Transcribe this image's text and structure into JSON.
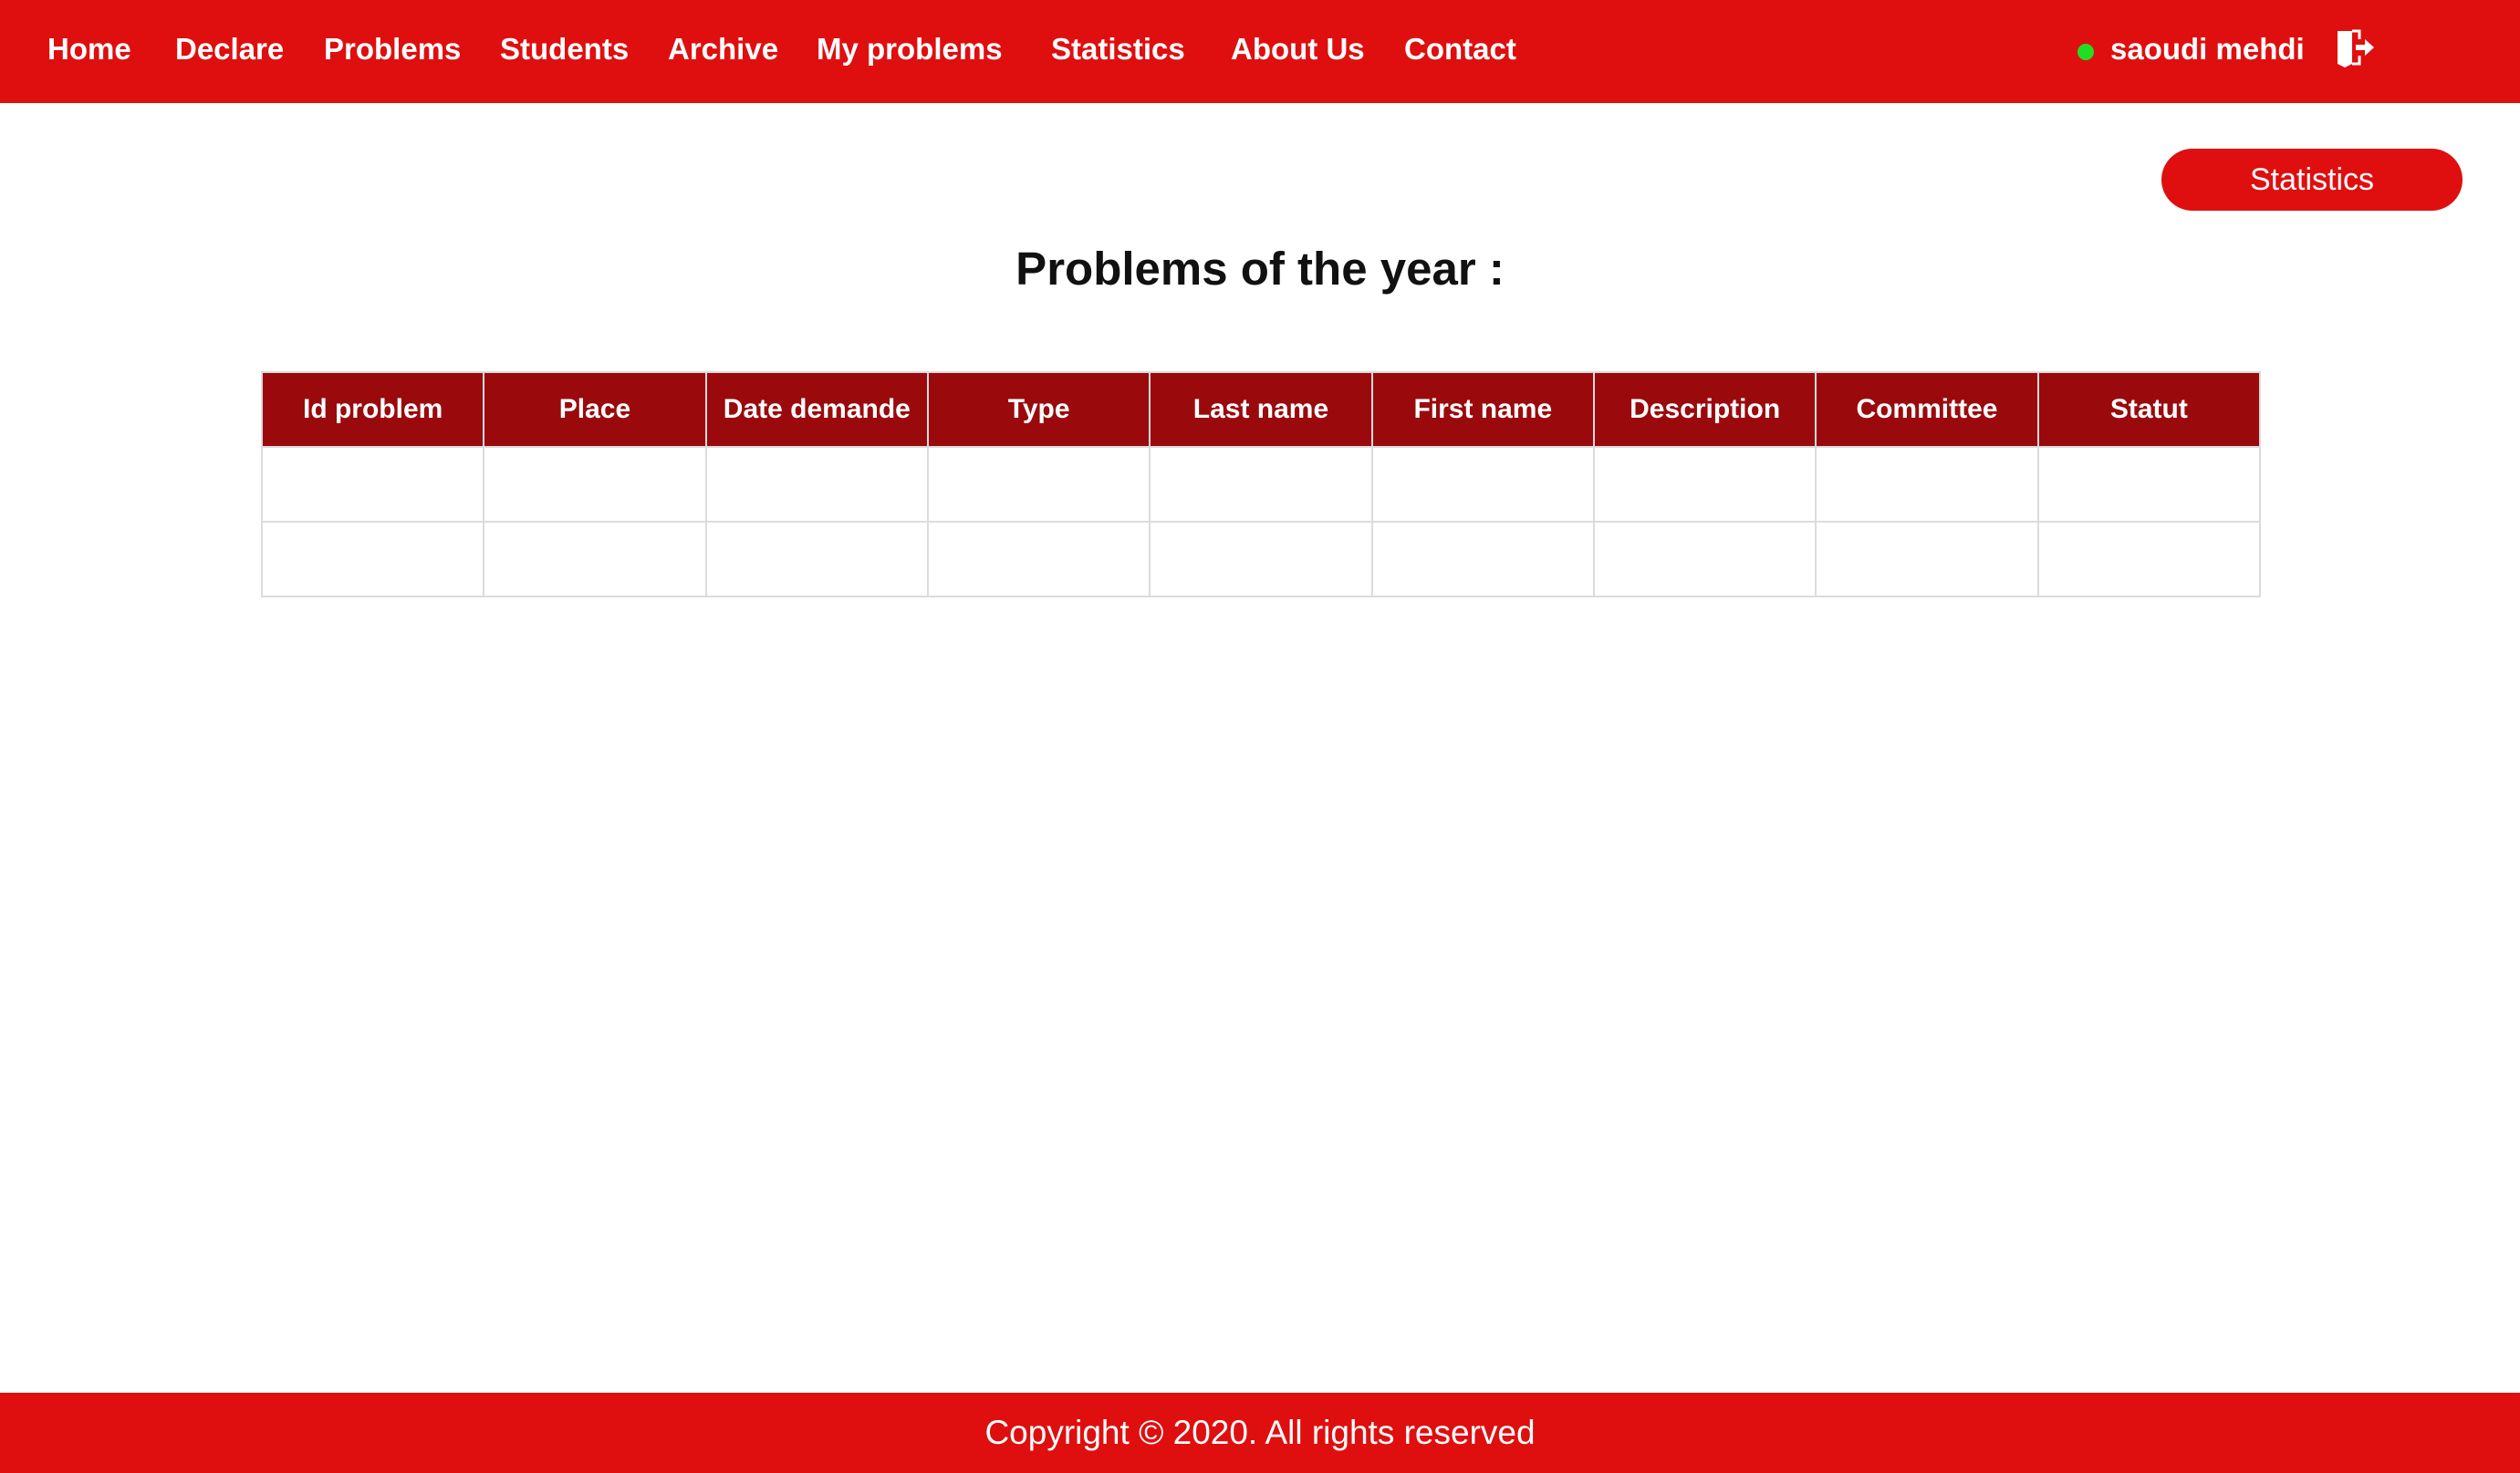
{
  "nav": {
    "items": [
      {
        "label": "Home"
      },
      {
        "label": "Declare"
      },
      {
        "label": "Problems"
      },
      {
        "label": "Students"
      },
      {
        "label": "Archive"
      },
      {
        "label": "My problems"
      },
      {
        "label": "Statistics"
      },
      {
        "label": "About Us"
      },
      {
        "label": "Contact"
      }
    ],
    "user": {
      "name": "saoudi mehdi",
      "status_color": "#22dd22",
      "logout_icon": "logout-door-icon"
    }
  },
  "main": {
    "stats_button_label": "Statistics",
    "title": "Problems of the year :",
    "table": {
      "columns": [
        "Id problem",
        "Place",
        "Date demande",
        "Type",
        "Last name",
        "First name",
        "Description",
        "Committee",
        "Statut"
      ],
      "rows": [
        [
          "",
          "",
          "",
          "",
          "",
          "",
          "",
          "",
          ""
        ],
        [
          "",
          "",
          "",
          "",
          "",
          "",
          "",
          "",
          ""
        ]
      ]
    }
  },
  "footer": {
    "text": "Copyright © 2020. All rights reserved"
  },
  "colors": {
    "brand": "#df0f0f",
    "table_header": "#9a0a0d",
    "status_online": "#22dd22"
  }
}
